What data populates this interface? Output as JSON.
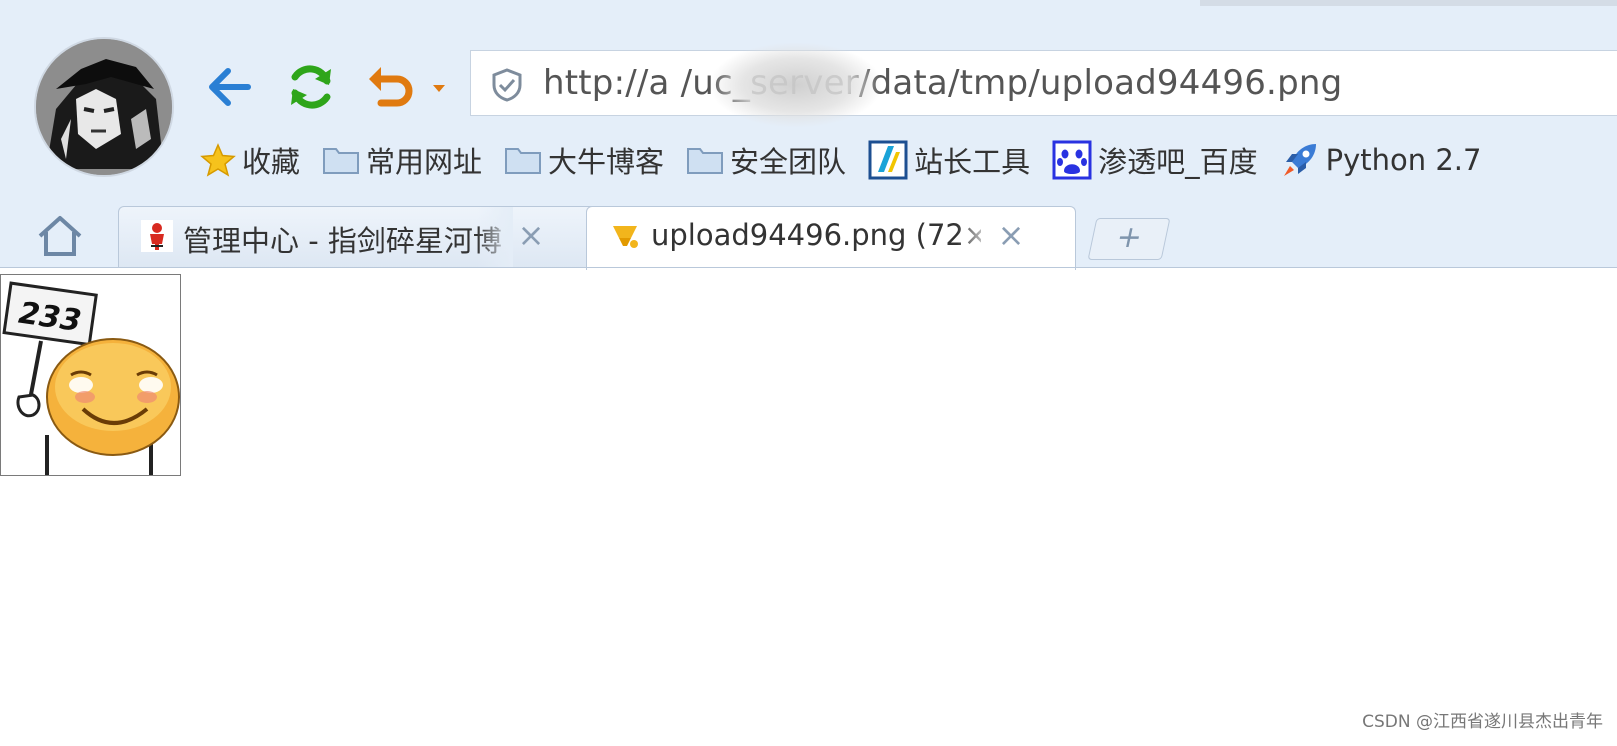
{
  "browser": {
    "url": "http://a        /uc_server/data/tmp/upload94496.png"
  },
  "bookmarks": [
    {
      "label": "收藏",
      "icon": "star-icon"
    },
    {
      "label": "常用网址",
      "icon": "folder-icon"
    },
    {
      "label": "大牛博客",
      "icon": "folder-icon"
    },
    {
      "label": "安全团队",
      "icon": "folder-icon"
    },
    {
      "label": "站长工具",
      "icon": "webmaster-tool-icon"
    },
    {
      "label": "渗透吧_百度",
      "icon": "baidu-paw-icon"
    },
    {
      "label": "Python 2.7",
      "icon": "rocket-icon"
    }
  ],
  "tabs": [
    {
      "title": "管理中心 - 指剑碎星河博",
      "close": "×",
      "active": false
    },
    {
      "title": "upload94496.png (72×",
      "close": "×",
      "active": true
    }
  ],
  "newtab_label": "+",
  "image": {
    "sign_text": "233"
  },
  "watermark": "CSDN @江西省遂川县杰出青年",
  "colors": {
    "chrome_bg": "#e4eef9",
    "back_arrow": "#2a7fd4",
    "refresh": "#2ea51a",
    "undo": "#e07a10"
  }
}
